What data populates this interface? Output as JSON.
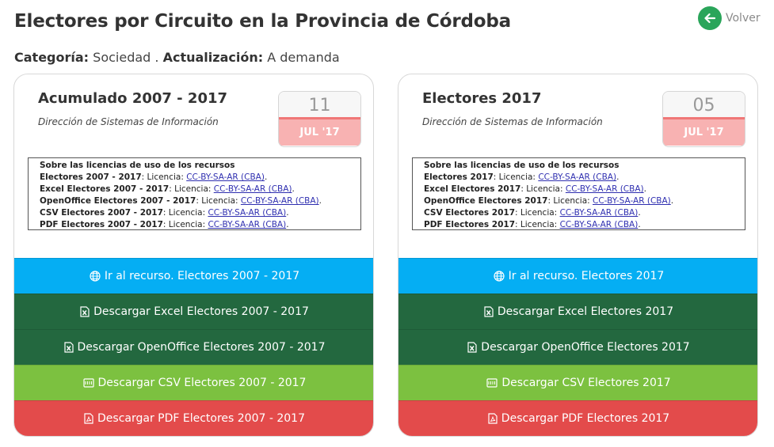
{
  "page": {
    "title": "Electores por Circuito en la Provincia de Córdoba",
    "back_label": "Volver",
    "category_label": "Categoría:",
    "category_value": "Sociedad .",
    "update_label": "Actualización:",
    "update_value": "A demanda"
  },
  "colors": {
    "back_button": "#2aa55a",
    "web_button": "#05aef3",
    "excel_button": "#23683f",
    "openoffice_button": "#23683f",
    "csv_button": "#7cc140",
    "pdf_button": "#e34b4b",
    "date_month_bg": "#f8b2b2"
  },
  "cards": [
    {
      "title": "Acumulado 2007 - 2017",
      "subtitle": "Dirección de Sistemas de Información",
      "date_day": "11",
      "date_month": "JUL '17",
      "license_title": "Sobre las licencias de uso de los recursos",
      "licenses": [
        {
          "name": "Electores 2007 - 2017",
          "prefix": ": Licencia: ",
          "link": "CC-BY-SA-AR (CBA)",
          "suffix": "."
        },
        {
          "name": "Excel Electores 2007 - 2017",
          "prefix": ": Licencia: ",
          "link": "CC-BY-SA-AR (CBA)",
          "suffix": "."
        },
        {
          "name": "OpenOffice Electores 2007 - 2017",
          "prefix": ": Licencia: ",
          "link": "CC-BY-SA-AR (CBA)",
          "suffix": "."
        },
        {
          "name": "CSV Electores 2007 - 2017",
          "prefix": ": Licencia: ",
          "link": "CC-BY-SA-AR (CBA)",
          "suffix": "."
        },
        {
          "name": "PDF Electores 2007 - 2017",
          "prefix": ": Licencia: ",
          "link": "CC-BY-SA-AR (CBA)",
          "suffix": "."
        }
      ],
      "buttons": {
        "web": "Ir al recurso. Electores 2007 - 2017",
        "excel": "Descargar Excel Electores 2007 - 2017",
        "openoffice": "Descargar OpenOffice Electores 2007 - 2017",
        "csv": "Descargar CSV Electores 2007 - 2017",
        "pdf": "Descargar PDF Electores 2007 - 2017"
      }
    },
    {
      "title": "Electores 2017",
      "subtitle": "Dirección de Sistemas de Información",
      "date_day": "05",
      "date_month": "JUL '17",
      "license_title": "Sobre las licencias de uso de los recursos",
      "licenses": [
        {
          "name": "Electores 2017",
          "prefix": ": Licencia: ",
          "link": "CC-BY-SA-AR (CBA)",
          "suffix": "."
        },
        {
          "name": "Excel Electores 2017",
          "prefix": ": Licencia: ",
          "link": "CC-BY-SA-AR (CBA)",
          "suffix": "."
        },
        {
          "name": "OpenOffice Electores 2017",
          "prefix": ": Licencia: ",
          "link": "CC-BY-SA-AR (CBA)",
          "suffix": "."
        },
        {
          "name": "CSV Electores 2017",
          "prefix": ": Licencia: ",
          "link": "CC-BY-SA-AR (CBA)",
          "suffix": "."
        },
        {
          "name": "PDF Electores 2017",
          "prefix": ": Licencia: ",
          "link": "CC-BY-SA-AR (CBA)",
          "suffix": "."
        }
      ],
      "buttons": {
        "web": "Ir al recurso. Electores 2017",
        "excel": "Descargar Excel Electores 2017",
        "openoffice": "Descargar OpenOffice Electores 2017",
        "csv": "Descargar CSV Electores 2017",
        "pdf": "Descargar PDF Electores 2017"
      }
    }
  ]
}
